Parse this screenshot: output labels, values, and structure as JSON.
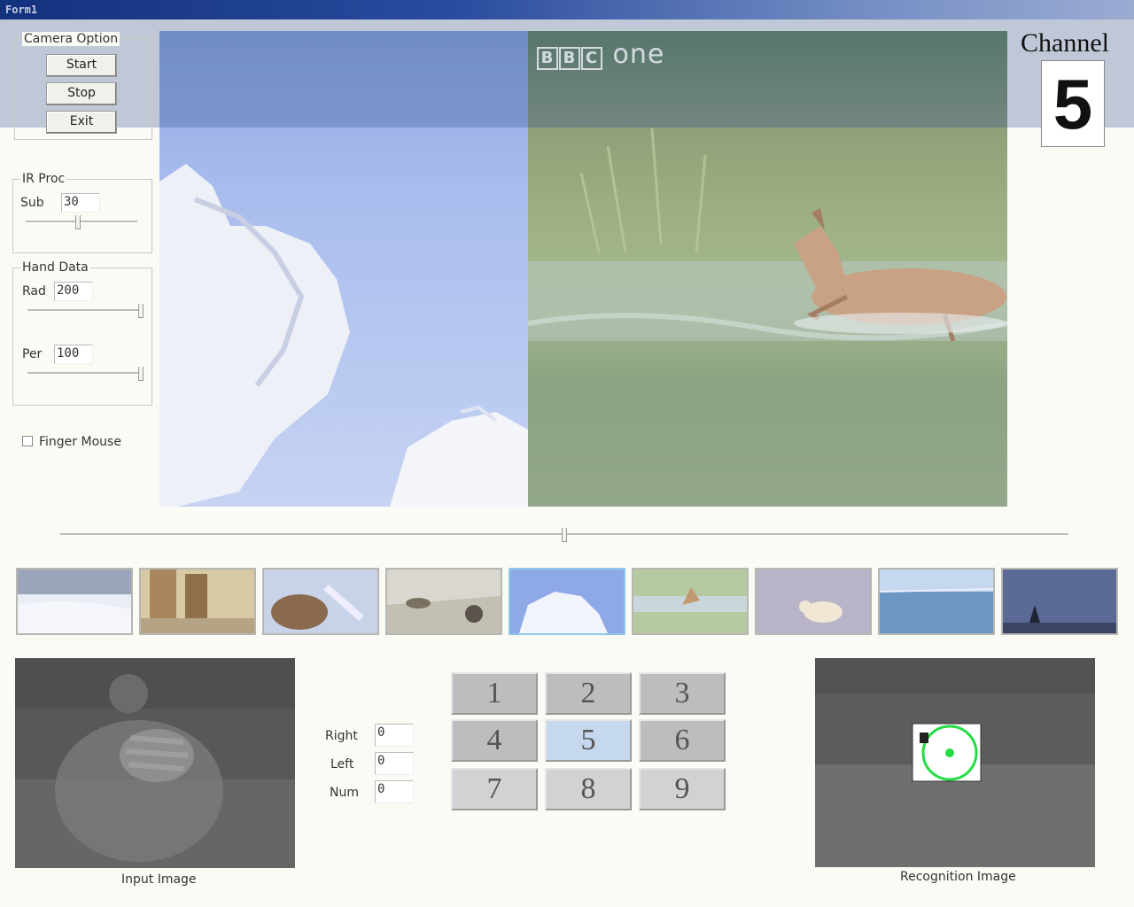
{
  "window": {
    "title": "Form1"
  },
  "camera_option": {
    "title": "Camera Option",
    "start_label": "Start",
    "stop_label": "Stop",
    "exit_label": "Exit"
  },
  "ir_proc": {
    "title": "IR Proc",
    "sub_label": "Sub",
    "sub_value": "30",
    "sub_slider_level": 0.47
  },
  "hand_data": {
    "title": "Hand Data",
    "rad_label": "Rad",
    "rad_value": "200",
    "rad_slider_level": 1.0,
    "per_label": "Per",
    "per_value": "100",
    "per_slider_level": 1.0
  },
  "finger_mouse": {
    "label": "Finger Mouse",
    "checked": false
  },
  "video": {
    "logo_text": "one",
    "logo_boxes": [
      "B",
      "B",
      "C"
    ]
  },
  "channel": {
    "label": "Channel",
    "number": "5"
  },
  "timeline": {
    "position": 0.5
  },
  "thumbnails": {
    "selected_index": 4,
    "items": [
      "snowy-landscape",
      "canyon-cliffs",
      "bear-fishing",
      "grassland-animal",
      "iceberg",
      "leaping-antelope",
      "polar-bear-shallows",
      "ocean-horizon",
      "night-sky-tree"
    ]
  },
  "readouts": {
    "right_label": "Right",
    "right_value": "0",
    "left_label": "Left",
    "left_value": "0",
    "num_label": "Num",
    "num_value": "0"
  },
  "keypad": {
    "keys": [
      "1",
      "2",
      "3",
      "4",
      "5",
      "6",
      "7",
      "8",
      "9"
    ],
    "active_key": "5"
  },
  "input_image": {
    "caption": "Input Image"
  },
  "recognition_image": {
    "caption": "Recognition Image"
  },
  "colors": {
    "accent": "#8ec7ee",
    "recognition_marker": "#22dd44",
    "titlebar": "#0b2a78"
  }
}
